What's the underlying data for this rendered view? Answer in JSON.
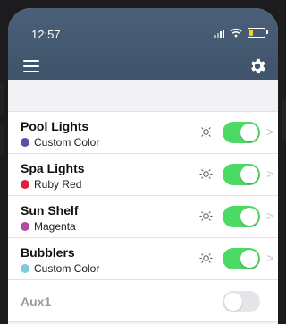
{
  "status_bar": {
    "time": "12:57"
  },
  "header": {
    "menu_icon": "hamburger-menu-icon",
    "settings_icon": "gear-icon"
  },
  "colors": {
    "header_bg": "#445870",
    "toggle_on": "#4cd964",
    "toggle_off": "#e6e6ea"
  },
  "lights": [
    {
      "name": "Pool Lights",
      "color_label": "Custom Color",
      "color": "#5552a8",
      "on": true
    },
    {
      "name": "Spa Lights",
      "color_label": "Ruby Red",
      "color": "#e0213c",
      "on": true
    },
    {
      "name": "Sun Shelf",
      "color_label": "Magenta",
      "color": "#b04aa5",
      "on": true
    },
    {
      "name": "Bubblers",
      "color_label": "Custom Color",
      "color": "#7ccbe0",
      "on": true
    }
  ],
  "aux": [
    {
      "name": "Aux1",
      "on": false
    }
  ]
}
